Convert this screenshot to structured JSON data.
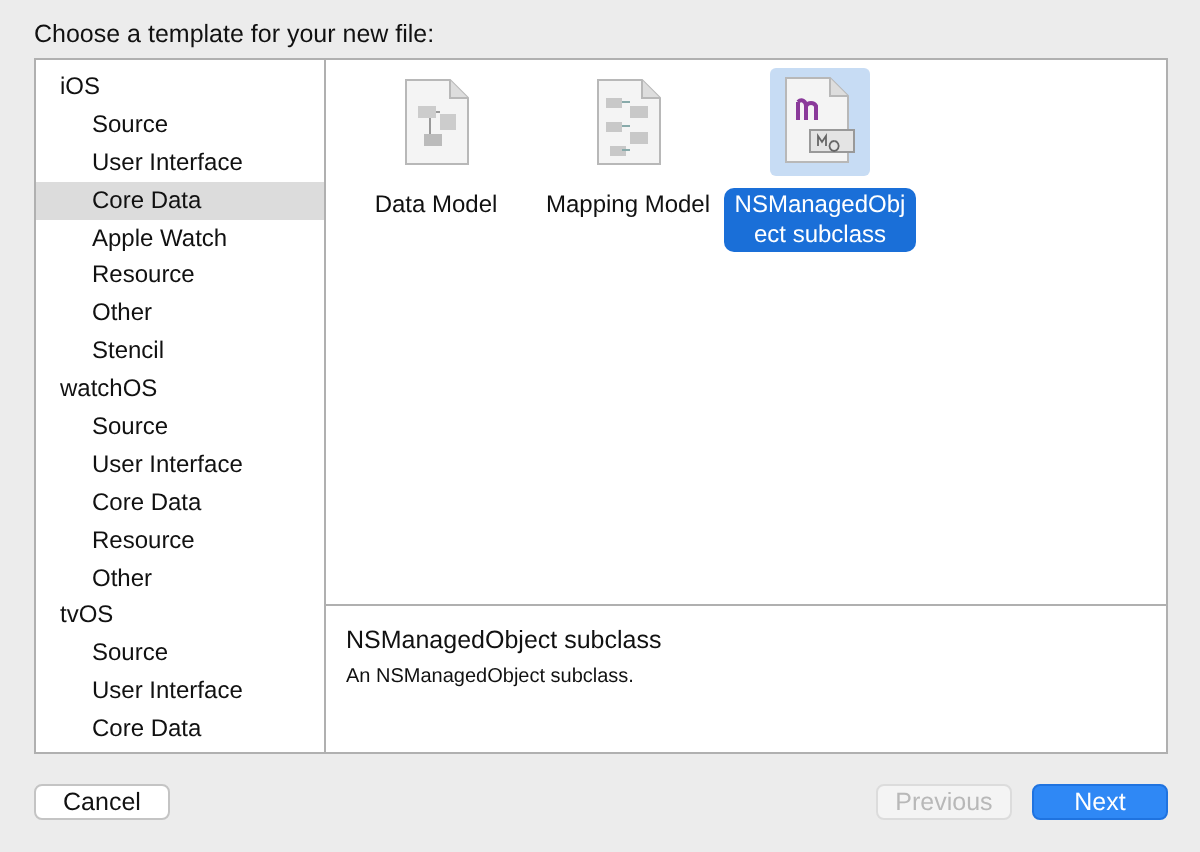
{
  "prompt": "Choose a template for your new file:",
  "sidebar": {
    "items": [
      {
        "label": "iOS",
        "selected": false,
        "children": [
          {
            "label": "Source",
            "selected": false
          },
          {
            "label": "User Interface",
            "selected": false
          },
          {
            "label": "Core Data",
            "selected": true
          },
          {
            "label": "Apple Watch",
            "selected": false
          },
          {
            "label": "Resource",
            "selected": false
          },
          {
            "label": "Other",
            "selected": false
          },
          {
            "label": "Stencil",
            "selected": false
          }
        ]
      },
      {
        "label": "watchOS",
        "selected": false,
        "children": [
          {
            "label": "Source",
            "selected": false
          },
          {
            "label": "User Interface",
            "selected": false
          },
          {
            "label": "Core Data",
            "selected": false
          },
          {
            "label": "Resource",
            "selected": false
          },
          {
            "label": "Other",
            "selected": false
          }
        ]
      },
      {
        "label": "tvOS",
        "selected": false,
        "children": [
          {
            "label": "Source",
            "selected": false
          },
          {
            "label": "User Interface",
            "selected": false
          },
          {
            "label": "Core Data",
            "selected": false
          }
        ]
      }
    ]
  },
  "templates": [
    {
      "label": "Data Model",
      "kind": "model",
      "selected": false
    },
    {
      "label": "Mapping Model",
      "kind": "mapping",
      "selected": false
    },
    {
      "label": "NSManagedObject subclass",
      "kind": "class",
      "selected": true
    }
  ],
  "detail": {
    "title": "NSManagedObject subclass",
    "description": "An NSManagedObject subclass."
  },
  "buttons": [
    {
      "label": "Cancel",
      "disabled": false,
      "default": false
    },
    {
      "label": "Previous",
      "disabled": true,
      "default": false
    },
    {
      "label": "Next",
      "disabled": false,
      "default": true
    }
  ]
}
